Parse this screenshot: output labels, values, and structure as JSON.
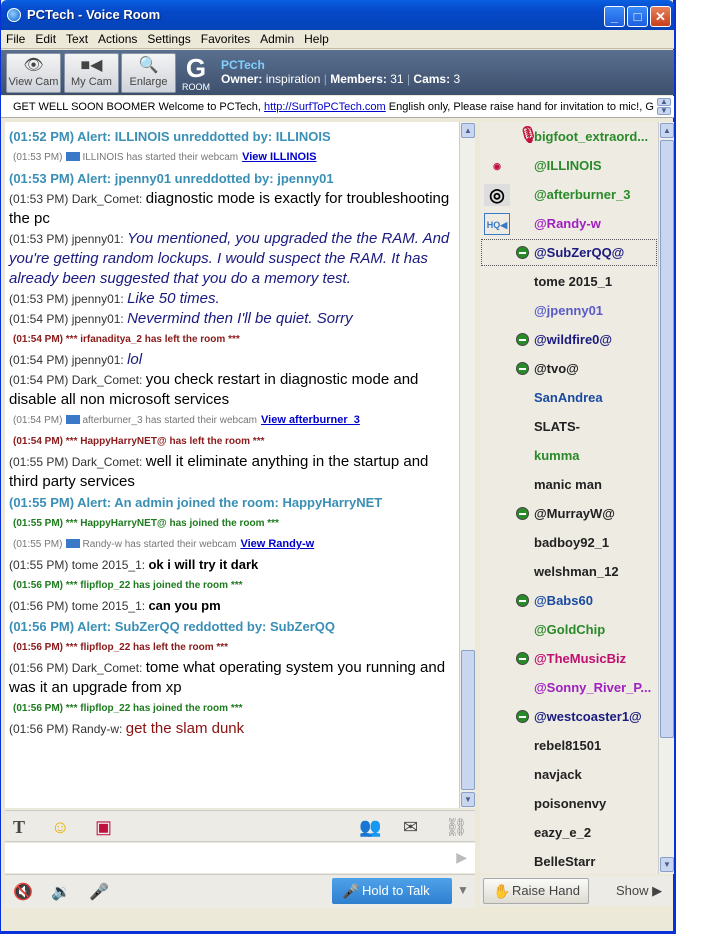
{
  "window": {
    "title": "PCTech - Voice Room",
    "min": "_",
    "max": "□",
    "close": "✕"
  },
  "menu": [
    "File",
    "Edit",
    "Text",
    "Actions",
    "Settings",
    "Favorites",
    "Admin",
    "Help"
  ],
  "toolbar": {
    "view_cam": "View Cam",
    "my_cam": "My Cam",
    "enlarge": "Enlarge",
    "room": "ROOM",
    "room_letter": "G",
    "room_name": "PCTech",
    "owner_label": "Owner:",
    "owner": "inspiration",
    "members_label": "Members:",
    "members": "31",
    "cams_label": "Cams:",
    "cams": "3"
  },
  "ticker": {
    "pre": "GET WELL SOON BOOMER Welcome to PCTech, ",
    "link": "http://SurfToPCTech.com",
    "post": " English only, Please raise hand for invitation to mic!, G"
  },
  "chat": [
    {
      "k": "alert",
      "text": "(01:52 PM) Alert: ILLINOIS unreddotted by: ILLINOIS"
    },
    {
      "k": "cam",
      "time": "(01:53 PM)",
      "text": "ILLINOIS has started their webcam",
      "link": "View ILLINOIS"
    },
    {
      "k": "alert",
      "text": "(01:53 PM) Alert: jpenny01 unreddotted by: jpenny01"
    },
    {
      "k": "msg",
      "time": "(01:53 PM)",
      "user": "Dark_Comet:",
      "text": "diagnostic mode is exactly for troubleshooting the pc",
      "color": "#000",
      "italic": false
    },
    {
      "k": "msg",
      "time": "(01:53 PM)",
      "user": "jpenny01:",
      "text": "You mentioned, you upgraded the the RAM. And you're getting random lockups. I would suspect the RAM. It has already been suggested that you do a memory test.",
      "color": "#1a1a80",
      "italic": true
    },
    {
      "k": "msg",
      "time": "(01:53 PM)",
      "user": "jpenny01:",
      "text": "Like 50 times.",
      "color": "#1a1a80",
      "italic": true
    },
    {
      "k": "msg",
      "time": "(01:54 PM)",
      "user": "jpenny01:",
      "text": "Nevermind then I'll be quiet. Sorry",
      "color": "#1a1a80",
      "italic": true
    },
    {
      "k": "sysred",
      "text": "(01:54 PM) *** irfanaditya_2 has left the room ***"
    },
    {
      "k": "msg",
      "time": "(01:54 PM)",
      "user": "jpenny01:",
      "text": "lol",
      "color": "#1a1a80",
      "italic": true
    },
    {
      "k": "msg",
      "time": "(01:54 PM)",
      "user": "Dark_Comet:",
      "text": "you check restart in diagnostic mode and disable all non microsoft services",
      "color": "#000",
      "italic": false
    },
    {
      "k": "cam",
      "time": "(01:54 PM)",
      "text": "afterburner_3 has started their webcam",
      "link": "View afterburner_3"
    },
    {
      "k": "sysred",
      "text": "(01:54 PM) *** HappyHarryNET@ has left the room ***"
    },
    {
      "k": "msg",
      "time": "(01:55 PM)",
      "user": "Dark_Comet:",
      "text": "well it eliminate anything in the startup and third party services",
      "color": "#000",
      "italic": false
    },
    {
      "k": "alert",
      "text": "(01:55 PM) Alert: An admin joined the room: HappyHarryNET"
    },
    {
      "k": "sysgreen",
      "text": "(01:55 PM) *** HappyHarryNET@ has joined the room ***"
    },
    {
      "k": "cam",
      "time": "(01:55 PM)",
      "text": "Randy-w has started their webcam",
      "link": "View Randy-w"
    },
    {
      "k": "msgb",
      "time": "(01:55 PM)",
      "user": "tome 2015_1:",
      "text": "ok i will try it dark",
      "color": "#000"
    },
    {
      "k": "sysgreen",
      "text": "(01:56 PM) *** flipflop_22 has joined the room ***"
    },
    {
      "k": "msgb",
      "time": "(01:56 PM)",
      "user": "tome 2015_1:",
      "text": "can you pm",
      "color": "#000"
    },
    {
      "k": "alert",
      "text": "(01:56 PM) Alert: SubZerQQ reddotted by: SubZerQQ"
    },
    {
      "k": "sysred",
      "text": "(01:56 PM) *** flipflop_22 has left the room ***"
    },
    {
      "k": "msg",
      "time": "(01:56 PM)",
      "user": "Dark_Comet:",
      "text": "tome what operating system you running and was it an upgrade from xp",
      "color": "#000",
      "italic": false
    },
    {
      "k": "sysgreen",
      "text": "(01:56 PM) *** flipflop_22 has joined the room ***"
    },
    {
      "k": "msg",
      "time": "(01:56 PM)",
      "user": "Randy-w:",
      "text": "get the slam dunk",
      "color": "#8b1010",
      "italic": false
    }
  ],
  "users": [
    {
      "name": "bigfoot_extraord...",
      "color": "#2a8a2a",
      "mark": "mic"
    },
    {
      "name": "@ILLINOIS",
      "color": "#2a8a2a",
      "left": "eye"
    },
    {
      "name": "@afterburner_3",
      "color": "#2a8a2a",
      "left": "cam"
    },
    {
      "name": "@Randy-w",
      "color": "#a020c0",
      "left": "hq"
    },
    {
      "name": "@SubZerQQ@",
      "color": "#1a1a80",
      "mark": "red",
      "sel": true
    },
    {
      "name": "tome 2015_1",
      "color": "#222"
    },
    {
      "name": "@jpenny01",
      "color": "#5a5ac8"
    },
    {
      "name": "@wildfire0@",
      "color": "#1a1a80",
      "mark": "red"
    },
    {
      "name": "@tvo@",
      "color": "#222",
      "mark": "red"
    },
    {
      "name": "SanAndrea",
      "color": "#1a4aa0"
    },
    {
      "name": "SLATS-",
      "color": "#222"
    },
    {
      "name": "kumma",
      "color": "#2a8a2a"
    },
    {
      "name": "manic man",
      "color": "#222"
    },
    {
      "name": "@MurrayW@",
      "color": "#222",
      "mark": "red"
    },
    {
      "name": "badboy92_1",
      "color": "#222"
    },
    {
      "name": "welshman_12",
      "color": "#222"
    },
    {
      "name": "@Babs60",
      "color": "#1a4aa0",
      "mark": "red"
    },
    {
      "name": "@GoldChip",
      "color": "#2a8a2a"
    },
    {
      "name": "@TheMusicBiz",
      "color": "#c01070",
      "mark": "red"
    },
    {
      "name": "@Sonny_River_P...",
      "color": "#a020c0"
    },
    {
      "name": "@westcoaster1@",
      "color": "#1a1a80",
      "mark": "red"
    },
    {
      "name": "rebel81501",
      "color": "#222"
    },
    {
      "name": "navjack",
      "color": "#222"
    },
    {
      "name": "poisonenvy",
      "color": "#222"
    },
    {
      "name": "eazy_e_2",
      "color": "#222"
    },
    {
      "name": "BelleStarr",
      "color": "#222"
    }
  ],
  "controls": {
    "hold_to_talk": "Hold to Talk",
    "raise_hand": "Raise Hand",
    "show": "Show"
  }
}
